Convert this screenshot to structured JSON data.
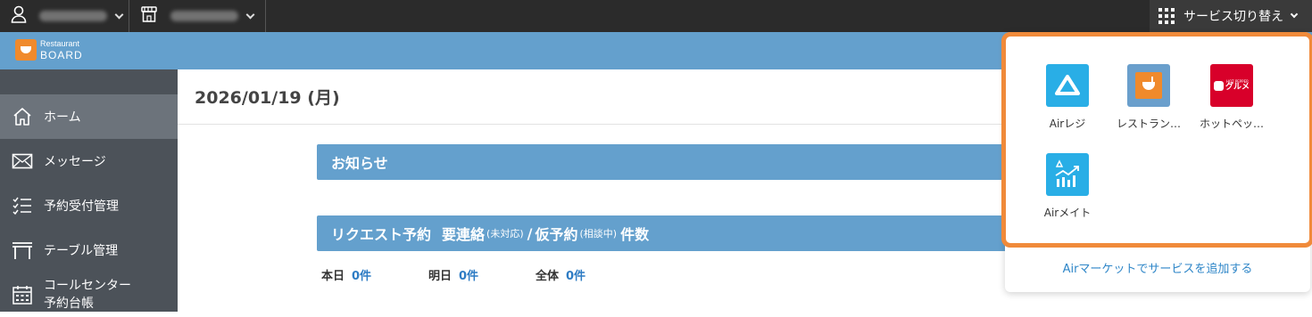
{
  "topbar": {
    "service_switch_label": "サービス切り替え",
    "icons": {
      "user": "user-icon",
      "store": "store-icon",
      "apps": "grid-icon"
    }
  },
  "brand": {
    "line1": "Restaurant",
    "line2": "BOARD"
  },
  "sidebar": {
    "items": [
      {
        "label": "ホーム",
        "icon": "home-icon",
        "active": true
      },
      {
        "label": "メッセージ",
        "icon": "mail-icon"
      },
      {
        "label": "予約受付管理",
        "icon": "checklist-icon"
      },
      {
        "label": "テーブル管理",
        "icon": "table-icon"
      },
      {
        "label_line1": "コールセンター",
        "label_line2": "予約台帳",
        "icon": "calendar-icon"
      }
    ]
  },
  "main": {
    "date": "2026/01/19 (月)",
    "notice_title": "お知らせ",
    "request": {
      "title_a": "リクエスト予約",
      "title_b": "要連絡",
      "title_b_note": "(未対応)",
      "title_sep": "/",
      "title_c": "仮予約",
      "title_c_note": "(相談中)",
      "title_d": "件数"
    },
    "counts": [
      {
        "label": "本日",
        "value": "0件"
      },
      {
        "label": "明日",
        "value": "0件"
      },
      {
        "label": "全体",
        "value": "0件"
      }
    ]
  },
  "service_menu": {
    "apps": [
      {
        "label": "Airレジ",
        "color": "#29aee6"
      },
      {
        "label": "レストラン…",
        "color": "#6a9fcc"
      },
      {
        "label": "ホットペッ…",
        "color": "#d8002a",
        "logo_text_small": "HOT PEPPER",
        "logo_text": "グルメ"
      },
      {
        "label": "Airメイト",
        "color": "#29aee6"
      }
    ],
    "add_link": "Airマーケットでサービスを追加する"
  },
  "colors": {
    "accent_blue": "#64a0cd",
    "highlight_orange": "#f08a3a",
    "sidebar": "#4c5259",
    "topbar": "#2b2b2b"
  }
}
